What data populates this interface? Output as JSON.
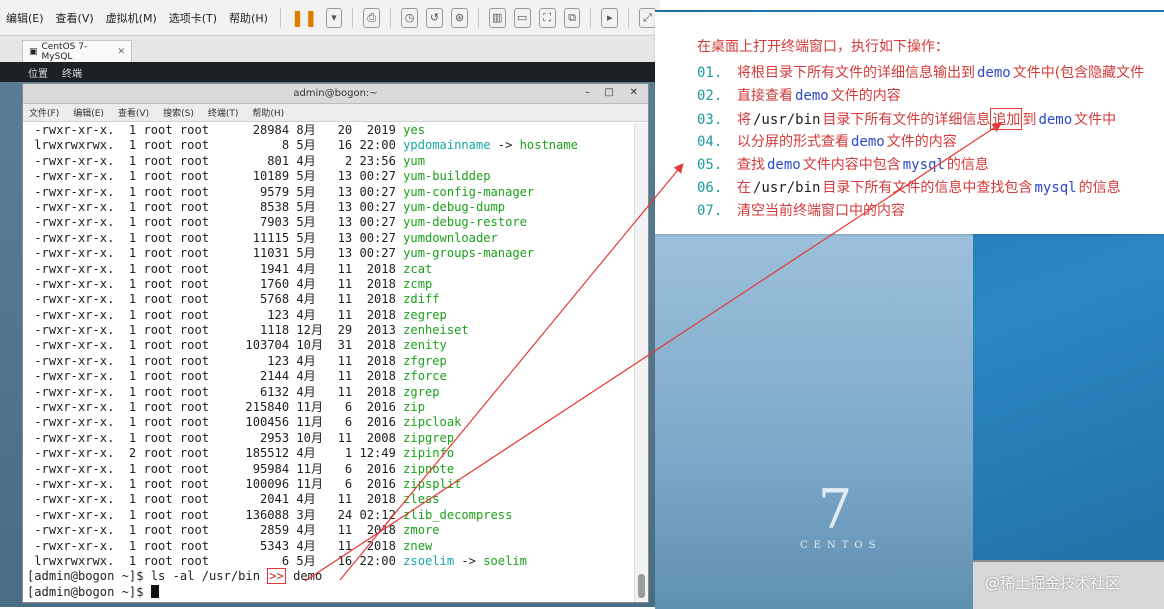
{
  "vm_menu": {
    "items": [
      "编辑(E)",
      "查看(V)",
      "虚拟机(M)",
      "选项卡(T)",
      "帮助(H)"
    ]
  },
  "tab": {
    "label": "CentOS 7-MySQL"
  },
  "gnome_bar": {
    "items": [
      "位置",
      "终端"
    ]
  },
  "terminal": {
    "title": "admin@bogon:~",
    "menu": [
      "文件(F)",
      "编辑(E)",
      "查看(V)",
      "搜索(S)",
      "终端(T)",
      "帮助(H)"
    ],
    "listing": [
      {
        "perm": "-rwxr-xr-x.",
        "links": "1",
        "owner": "root",
        "group": "root",
        "size": "28984",
        "month": "8月",
        "day": "20",
        "time": "2019",
        "name": "yes"
      },
      {
        "perm": "lrwxrwxrwx.",
        "links": "1",
        "owner": "root",
        "group": "root",
        "size": "8",
        "month": "5月",
        "day": "16",
        "time": "22:00",
        "name": "ypdomainname",
        "target": "hostname"
      },
      {
        "perm": "-rwxr-xr-x.",
        "links": "1",
        "owner": "root",
        "group": "root",
        "size": "801",
        "month": "4月",
        "day": "2",
        "time": "23:56",
        "name": "yum"
      },
      {
        "perm": "-rwxr-xr-x.",
        "links": "1",
        "owner": "root",
        "group": "root",
        "size": "10189",
        "month": "5月",
        "day": "13",
        "time": "00:27",
        "name": "yum-builddep"
      },
      {
        "perm": "-rwxr-xr-x.",
        "links": "1",
        "owner": "root",
        "group": "root",
        "size": "9579",
        "month": "5月",
        "day": "13",
        "time": "00:27",
        "name": "yum-config-manager"
      },
      {
        "perm": "-rwxr-xr-x.",
        "links": "1",
        "owner": "root",
        "group": "root",
        "size": "8538",
        "month": "5月",
        "day": "13",
        "time": "00:27",
        "name": "yum-debug-dump"
      },
      {
        "perm": "-rwxr-xr-x.",
        "links": "1",
        "owner": "root",
        "group": "root",
        "size": "7903",
        "month": "5月",
        "day": "13",
        "time": "00:27",
        "name": "yum-debug-restore"
      },
      {
        "perm": "-rwxr-xr-x.",
        "links": "1",
        "owner": "root",
        "group": "root",
        "size": "11115",
        "month": "5月",
        "day": "13",
        "time": "00:27",
        "name": "yumdownloader"
      },
      {
        "perm": "-rwxr-xr-x.",
        "links": "1",
        "owner": "root",
        "group": "root",
        "size": "11031",
        "month": "5月",
        "day": "13",
        "time": "00:27",
        "name": "yum-groups-manager"
      },
      {
        "perm": "-rwxr-xr-x.",
        "links": "1",
        "owner": "root",
        "group": "root",
        "size": "1941",
        "month": "4月",
        "day": "11",
        "time": "2018",
        "name": "zcat"
      },
      {
        "perm": "-rwxr-xr-x.",
        "links": "1",
        "owner": "root",
        "group": "root",
        "size": "1760",
        "month": "4月",
        "day": "11",
        "time": "2018",
        "name": "zcmp"
      },
      {
        "perm": "-rwxr-xr-x.",
        "links": "1",
        "owner": "root",
        "group": "root",
        "size": "5768",
        "month": "4月",
        "day": "11",
        "time": "2018",
        "name": "zdiff"
      },
      {
        "perm": "-rwxr-xr-x.",
        "links": "1",
        "owner": "root",
        "group": "root",
        "size": "123",
        "month": "4月",
        "day": "11",
        "time": "2018",
        "name": "zegrep"
      },
      {
        "perm": "-rwxr-xr-x.",
        "links": "1",
        "owner": "root",
        "group": "root",
        "size": "1118",
        "month": "12月",
        "day": "29",
        "time": "2013",
        "name": "zenheiset"
      },
      {
        "perm": "-rwxr-xr-x.",
        "links": "1",
        "owner": "root",
        "group": "root",
        "size": "103704",
        "month": "10月",
        "day": "31",
        "time": "2018",
        "name": "zenity"
      },
      {
        "perm": "-rwxr-xr-x.",
        "links": "1",
        "owner": "root",
        "group": "root",
        "size": "123",
        "month": "4月",
        "day": "11",
        "time": "2018",
        "name": "zfgrep"
      },
      {
        "perm": "-rwxr-xr-x.",
        "links": "1",
        "owner": "root",
        "group": "root",
        "size": "2144",
        "month": "4月",
        "day": "11",
        "time": "2018",
        "name": "zforce"
      },
      {
        "perm": "-rwxr-xr-x.",
        "links": "1",
        "owner": "root",
        "group": "root",
        "size": "6132",
        "month": "4月",
        "day": "11",
        "time": "2018",
        "name": "zgrep"
      },
      {
        "perm": "-rwxr-xr-x.",
        "links": "1",
        "owner": "root",
        "group": "root",
        "size": "215840",
        "month": "11月",
        "day": "6",
        "time": "2016",
        "name": "zip"
      },
      {
        "perm": "-rwxr-xr-x.",
        "links": "1",
        "owner": "root",
        "group": "root",
        "size": "100456",
        "month": "11月",
        "day": "6",
        "time": "2016",
        "name": "zipcloak"
      },
      {
        "perm": "-rwxr-xr-x.",
        "links": "1",
        "owner": "root",
        "group": "root",
        "size": "2953",
        "month": "10月",
        "day": "11",
        "time": "2008",
        "name": "zipgrep"
      },
      {
        "perm": "-rwxr-xr-x.",
        "links": "2",
        "owner": "root",
        "group": "root",
        "size": "185512",
        "month": "4月",
        "day": "1",
        "time": "12:49",
        "name": "zipinfo"
      },
      {
        "perm": "-rwxr-xr-x.",
        "links": "1",
        "owner": "root",
        "group": "root",
        "size": "95984",
        "month": "11月",
        "day": "6",
        "time": "2016",
        "name": "zipnote"
      },
      {
        "perm": "-rwxr-xr-x.",
        "links": "1",
        "owner": "root",
        "group": "root",
        "size": "100096",
        "month": "11月",
        "day": "6",
        "time": "2016",
        "name": "zipsplit"
      },
      {
        "perm": "-rwxr-xr-x.",
        "links": "1",
        "owner": "root",
        "group": "root",
        "size": "2041",
        "month": "4月",
        "day": "11",
        "time": "2018",
        "name": "zless"
      },
      {
        "perm": "-rwxr-xr-x.",
        "links": "1",
        "owner": "root",
        "group": "root",
        "size": "136088",
        "month": "3月",
        "day": "24",
        "time": "02:12",
        "name": "zlib_decompress"
      },
      {
        "perm": "-rwxr-xr-x.",
        "links": "1",
        "owner": "root",
        "group": "root",
        "size": "2859",
        "month": "4月",
        "day": "11",
        "time": "2018",
        "name": "zmore"
      },
      {
        "perm": "-rwxr-xr-x.",
        "links": "1",
        "owner": "root",
        "group": "root",
        "size": "5343",
        "month": "4月",
        "day": "11",
        "time": "2018",
        "name": "znew"
      },
      {
        "perm": "lrwxrwxrwx.",
        "links": "1",
        "owner": "root",
        "group": "root",
        "size": "6",
        "month": "5月",
        "day": "16",
        "time": "22:00",
        "name": "zsoelim",
        "target": "soelim"
      }
    ],
    "command": {
      "prompt": "[admin@bogon ~]$",
      "text": "ls -al /usr/bin",
      "operator": ">>",
      "arg": "demo"
    },
    "prompt2": "[admin@bogon ~]$"
  },
  "instructions": {
    "heading": "在桌面上打开终端窗口，执行如下操作：",
    "items": [
      {
        "num": "01.",
        "a": "将根目录下所有文件的详细信息输出到",
        "kw": "demo",
        "b": "文件中(包含隐藏文件"
      },
      {
        "num": "02.",
        "a": "直接查看",
        "kw": "demo",
        "b": "文件的内容"
      },
      {
        "num": "03.",
        "a": "将",
        "path": "/usr/bin",
        "c": "目录下所有文件的详细信息",
        "append": "追加",
        "d": "到",
        "kw": "demo",
        "b": "文件中"
      },
      {
        "num": "04.",
        "a": "以分屏的形式查看",
        "kw": "demo",
        "b": "文件的内容"
      },
      {
        "num": "05.",
        "a": "查找",
        "kw": "demo",
        "c": "文件内容中包含",
        "kw2": "mysql",
        "b": "的信息"
      },
      {
        "num": "06.",
        "a": "在",
        "path": "/usr/bin",
        "c": "目录下所有文件的信息中查找包含",
        "kw": "mysql",
        "b": "的信息"
      },
      {
        "num": "07.",
        "a": "清空当前终端窗口中的内容"
      }
    ]
  },
  "desktop": {
    "logo_number": "7",
    "logo_word": "CENTOS"
  },
  "watermark": "@稀土掘金技术社区",
  "colors": {
    "annotation_red": "#e53935",
    "filename_green": "#1aa11a",
    "link_cyan": "#17a7a7",
    "keyword_blue": "#2b49c7"
  }
}
